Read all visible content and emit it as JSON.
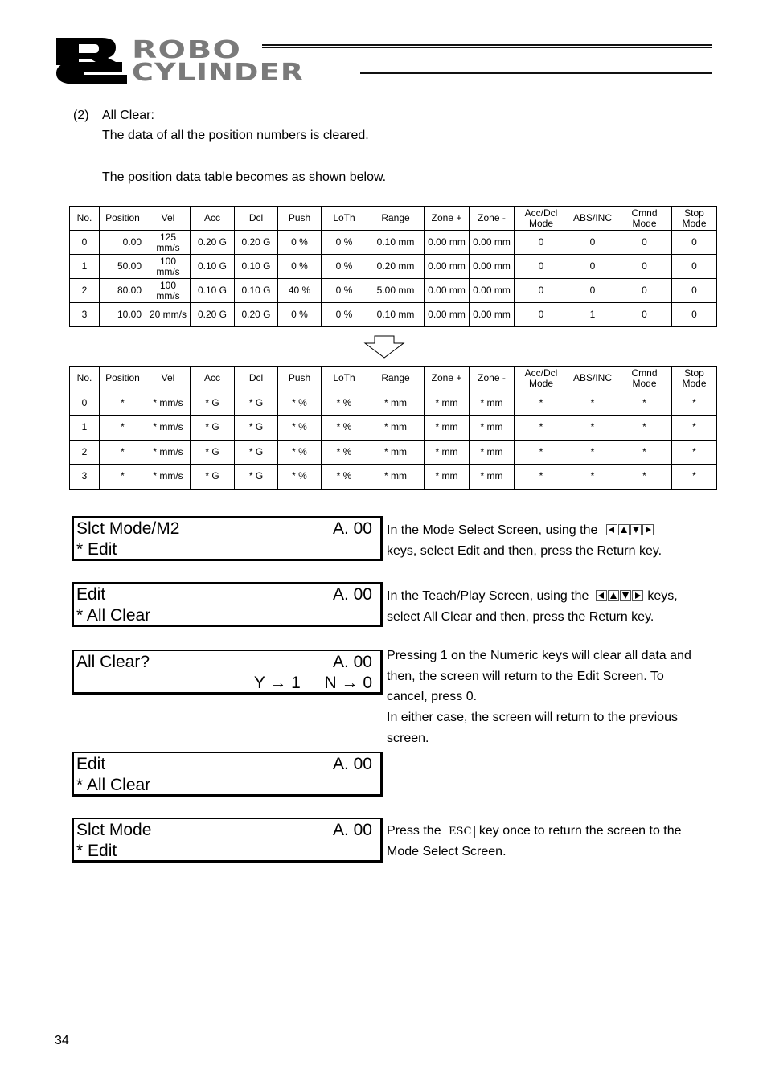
{
  "header": {
    "logo_initials": "RC",
    "brand_line1": "ROBO",
    "brand_line2": "CYLINDER"
  },
  "section": {
    "number": "(2)",
    "title": "All Clear:",
    "description": "The data of all the position numbers is cleared.",
    "table_intro": "The position data table becomes as shown below."
  },
  "table_columns": [
    "No.",
    "Position",
    "Vel",
    "Acc",
    "Dcl",
    "Push",
    "LoTh",
    "Range",
    "Zone +",
    "Zone -",
    "Acc/Dcl Mode",
    "ABS/INC",
    "Cmnd Mode",
    "Stop Mode"
  ],
  "table_before": {
    "rows": [
      [
        "0",
        "0.00",
        "125 mm/s",
        "0.20 G",
        "0.20 G",
        "0 %",
        "0 %",
        "0.10 mm",
        "0.00 mm",
        "0.00 mm",
        "0",
        "0",
        "0",
        "0"
      ],
      [
        "1",
        "50.00",
        "100 mm/s",
        "0.10 G",
        "0.10 G",
        "0 %",
        "0 %",
        "0.20 mm",
        "0.00 mm",
        "0.00 mm",
        "0",
        "0",
        "0",
        "0"
      ],
      [
        "2",
        "80.00",
        "100 mm/s",
        "0.10 G",
        "0.10 G",
        "40 %",
        "0 %",
        "5.00 mm",
        "0.00 mm",
        "0.00 mm",
        "0",
        "0",
        "0",
        "0"
      ],
      [
        "3",
        "10.00",
        "20 mm/s",
        "0.20 G",
        "0.20 G",
        "0 %",
        "0 %",
        "0.10 mm",
        "0.00 mm",
        "0.00 mm",
        "0",
        "1",
        "0",
        "0"
      ]
    ]
  },
  "table_after": {
    "rows": [
      [
        "0",
        "*",
        "* mm/s",
        "* G",
        "* G",
        "* %",
        "* %",
        "* mm",
        "* mm",
        "* mm",
        "*",
        "*",
        "*",
        "*"
      ],
      [
        "1",
        "*",
        "* mm/s",
        "* G",
        "* G",
        "* %",
        "* %",
        "* mm",
        "* mm",
        "* mm",
        "*",
        "*",
        "*",
        "*"
      ],
      [
        "2",
        "*",
        "* mm/s",
        "* G",
        "* G",
        "* %",
        "* %",
        "* mm",
        "* mm",
        "* mm",
        "*",
        "*",
        "*",
        "*"
      ],
      [
        "3",
        "*",
        "* mm/s",
        "* G",
        "* G",
        "* %",
        "* %",
        "* mm",
        "* mm",
        "* mm",
        "*",
        "*",
        "*",
        "*"
      ]
    ]
  },
  "screens": [
    {
      "line1": "Slct Mode/M2",
      "line2": "* Edit",
      "axis": "A. 00"
    },
    {
      "line1": "Edit",
      "line2": "* All Clear",
      "axis": "A. 00"
    },
    {
      "line1": "All Clear?",
      "line2": "",
      "axis": "A. 00",
      "yes": "Y → 1",
      "no": "N → 0"
    },
    {
      "line1": "Edit",
      "line2": "* All Clear",
      "axis": "A. 00"
    },
    {
      "line1": "Slct Mode",
      "line2": "* Edit",
      "axis": "A. 00"
    }
  ],
  "instructions": {
    "step1_a": "In the Mode Select Screen, using the",
    "step1_b": "keys, select Edit and then, press the Return key.",
    "step2_a": "In the Teach/Play Screen, using the",
    "step2_a2": "keys,",
    "step2_b": "select All Clear and then, press the Return key.",
    "step3": [
      "Pressing 1 on the Numeric keys will clear all data and",
      "then, the screen will return to the Edit Screen. To",
      "cancel, press 0.",
      "In either case, the screen will return to the previous",
      "screen."
    ],
    "step5_a": "Press the",
    "esc_key": "ESC",
    "step5_a2": "key once to return the screen to the",
    "step5_b": "Mode Select Screen."
  },
  "arrow_keys": [
    "left-arrow-key",
    "up-arrow-key",
    "down-arrow-key",
    "right-arrow-key"
  ],
  "page_number": "34"
}
